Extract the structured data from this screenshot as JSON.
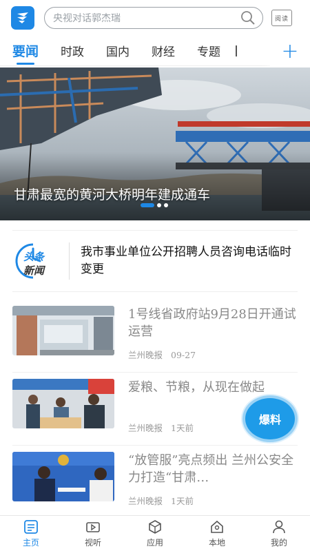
{
  "search": {
    "placeholder": "央视对话郭杰瑞"
  },
  "reader_icon": {
    "label": "阅读"
  },
  "tabs": [
    {
      "label": "要闻"
    },
    {
      "label": "时政"
    },
    {
      "label": "国内"
    },
    {
      "label": "财经"
    },
    {
      "label": "专题"
    }
  ],
  "banner": {
    "caption": "甘肃最宽的黄河大桥明年建成通车",
    "slides_total": 3,
    "active_slide": 1
  },
  "headline": {
    "logo_text_1": "头条",
    "logo_text_2": "新闻",
    "text": "我市事业单位公开招聘人员咨询电话临时变更"
  },
  "news": [
    {
      "title": "1号线省政府站9月28日开通试运营",
      "source": "兰州晚报",
      "time": "09-27"
    },
    {
      "title": "爱粮、节粮，从现在做起",
      "source": "兰州晚报",
      "time": "1天前"
    },
    {
      "title": "“放管服”亮点频出 兰州公安全力打造“甘肃…",
      "source": "兰州晚报",
      "time": "1天前"
    }
  ],
  "fab": {
    "label": "爆料"
  },
  "bottom_nav": [
    {
      "label": "主页",
      "icon": "home-icon"
    },
    {
      "label": "视听",
      "icon": "video-icon"
    },
    {
      "label": "应用",
      "icon": "apps-icon"
    },
    {
      "label": "本地",
      "icon": "local-icon"
    },
    {
      "label": "我的",
      "icon": "profile-icon"
    }
  ],
  "colors": {
    "accent": "#1e88e5",
    "fab": "#1e9be8"
  }
}
